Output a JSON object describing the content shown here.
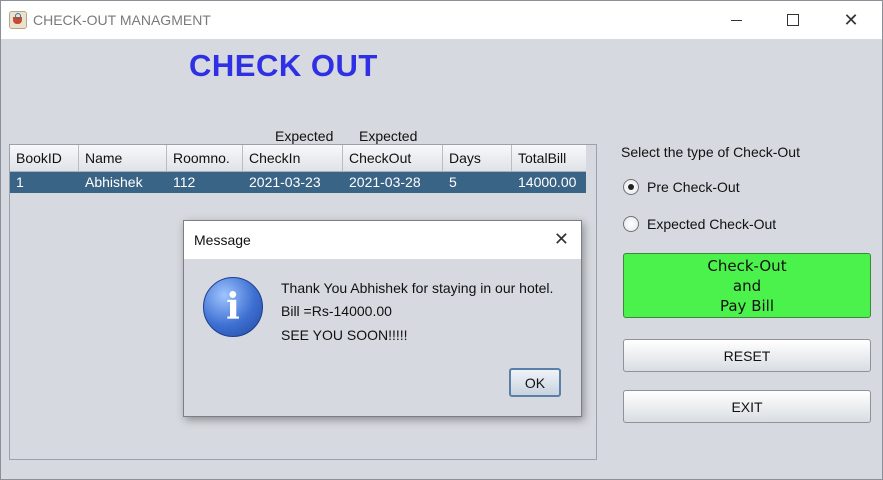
{
  "window": {
    "title": "CHECK-OUT MANAGMENT",
    "minimize_glyph": "",
    "maximize_glyph": "",
    "close_glyph": "✕"
  },
  "heading": "CHECK OUT",
  "column_prefix": {
    "checkin": "Expected",
    "checkout": "Expected"
  },
  "table": {
    "headers": [
      "BookID",
      "Name",
      "Roomno.",
      "CheckIn",
      "CheckOut",
      "Days",
      "TotalBill"
    ],
    "rows": [
      [
        "1",
        "Abhishek",
        "112",
        "2021-03-23",
        "2021-03-28",
        "5",
        "14000.00"
      ]
    ]
  },
  "checkout_type": {
    "label": "Select the type of Check-Out",
    "options": [
      {
        "label": "Pre Check-Out",
        "selected": true
      },
      {
        "label": "Expected Check-Out",
        "selected": false
      }
    ]
  },
  "buttons": {
    "pay": [
      "Check-Out",
      "and",
      "Pay Bill"
    ],
    "reset": "RESET",
    "exit": "EXIT"
  },
  "dialog": {
    "title": "Message",
    "close_glyph": "✕",
    "icon": "info-icon",
    "icon_glyph": "i",
    "lines": [
      "Thank You Abhishek for staying in our hotel.",
      "Bill =Rs-14000.00",
      "SEE YOU SOON!!!!!"
    ],
    "ok": "OK"
  },
  "colors": {
    "heading": "#2f2fe6",
    "pay_button": "#4cf24c",
    "selected_row": "#3a6486"
  }
}
